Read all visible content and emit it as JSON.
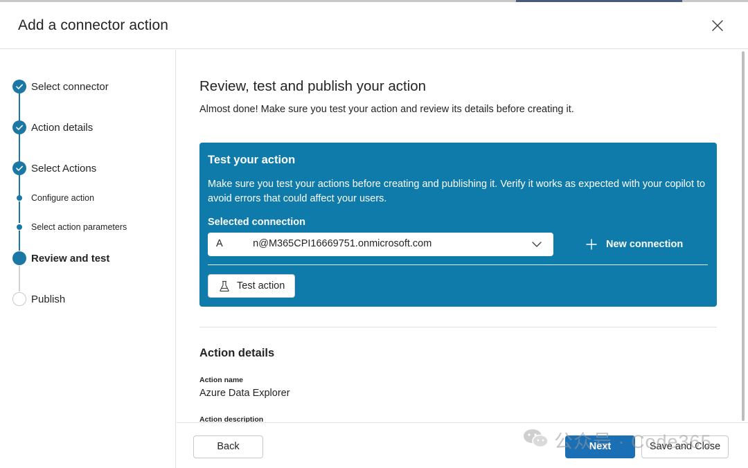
{
  "dialog": {
    "title": "Add a connector action"
  },
  "steps": [
    {
      "label": "Select connector",
      "state": "done"
    },
    {
      "label": "Action details",
      "state": "done"
    },
    {
      "label": "Select Actions",
      "state": "done"
    },
    {
      "label": "Configure action",
      "state": "sub-done"
    },
    {
      "label": "Select action parameters",
      "state": "sub-done"
    },
    {
      "label": "Review and test",
      "state": "current"
    },
    {
      "label": "Publish",
      "state": "pending"
    }
  ],
  "main": {
    "heading": "Review, test and publish your action",
    "subtitle": "Almost done! Make sure you test your action and review its details before creating it.",
    "test_card": {
      "title": "Test your action",
      "description": "Make sure you test your actions before creating and publishing it. Verify it works as expected with your copilot to avoid errors that could affect your users.",
      "connection_label": "Selected connection",
      "connection_value": "A      n@M365CPI16669751.onmicrosoft.com",
      "new_connection_label": "New connection",
      "test_button_label": "Test action"
    },
    "details": {
      "heading": "Action details",
      "action_name_label": "Action name",
      "action_name_value": "Azure Data Explorer",
      "action_description_label": "Action description"
    }
  },
  "footer": {
    "back_label": "Back",
    "next_label": "Next",
    "save_close_label": "Save and Close"
  },
  "watermark": {
    "text": "公众号 · Code365"
  },
  "colors": {
    "accent": "#1a77a6",
    "card_bg": "#0e7bab",
    "primary_button": "#1a6fb5"
  },
  "icons": [
    "close-icon",
    "checkmark-icon",
    "chevron-down-icon",
    "plus-icon",
    "beaker-icon",
    "wechat-icon"
  ]
}
